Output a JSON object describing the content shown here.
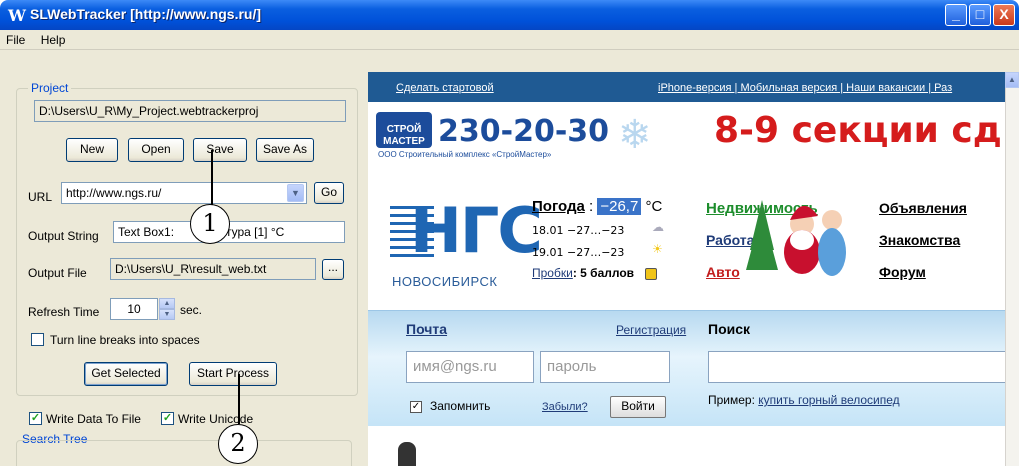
{
  "window": {
    "icon_glyph": "W",
    "title": "SLWebTracker [http://www.ngs.ru/]",
    "minimize": "_",
    "maximize": "□",
    "close": "X"
  },
  "menu": {
    "items": [
      "File",
      "Help"
    ]
  },
  "project": {
    "group_label": "Project",
    "path": "D:\\Users\\U_R\\My_Project.webtrackerproj",
    "new_label": "New",
    "open_label": "Open",
    "save_label": "Save",
    "save_as_label": "Save As",
    "url_label": "URL",
    "url_value": "http://www.ngs.ru/",
    "go_label": "Go",
    "output_string_label": "Output String",
    "output_string_value": "Text Box1:",
    "output_string_tail": "тура [1] °C",
    "output_file_label": "Output File",
    "output_file_value": "D:\\Users\\U_R\\result_web.txt",
    "browse_label": "...",
    "refresh_label": "Refresh Time",
    "refresh_value": "10",
    "refresh_unit": "sec.",
    "line_breaks_label": "Turn line breaks into spaces",
    "get_selected_label": "Get Selected",
    "start_process_label": "Start Process",
    "write_data_label": "Write Data To File",
    "write_unicode_label": "Write Unicode",
    "search_tree_label": "Search Tree"
  },
  "callouts": {
    "one": "1",
    "two": "2"
  },
  "browser": {
    "top_links": {
      "make_start": "Сделать стартовой",
      "right_links": "iPhone-версия | Мобильная версия | Наши вакансии | Раз"
    },
    "ad": {
      "logo_text": "СТРОЙ МАСТЕР",
      "phone": "230-20-30",
      "sub": "ООО Строительный комплекс «СтройМастер»",
      "right_text": "8-9 секции сд"
    },
    "ngs": {
      "letters": "НГС",
      "city": "НОВОСИБИРСК"
    },
    "weather": {
      "label": "Погода",
      "colon": " : ",
      "temp": "−26,7",
      "unit": " °C",
      "fc1": "18.01   −27…−23",
      "fc2": "19.01   −27…−23",
      "traffic_label": "Пробки",
      "traffic_value": ": 5 баллов"
    },
    "links": {
      "realty": "Недвижимость",
      "ads": "Объявления",
      "work": "Работа",
      "dating": "Знакомства",
      "auto": "Авто",
      "forum": "Форум"
    },
    "mail": {
      "title": "Почта",
      "register": "Регистрация",
      "login_placeholder": "имя@ngs.ru",
      "password_placeholder": "пароль",
      "remember": "Запомнить",
      "forgot": "Забыли?",
      "enter": "Войти"
    },
    "search": {
      "title": "Поиск",
      "example_label": "Пример: ",
      "example_link": "купить горный велосипед"
    }
  }
}
